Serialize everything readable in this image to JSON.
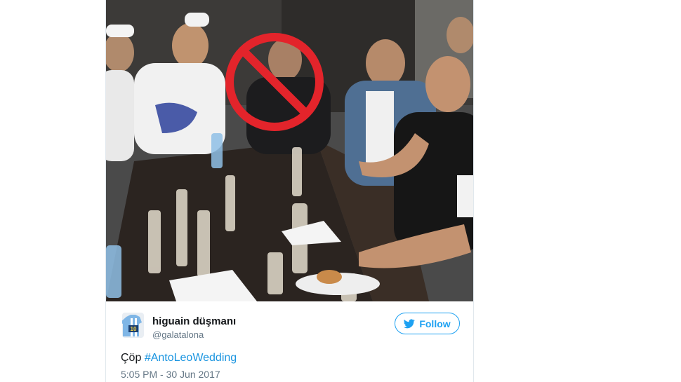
{
  "tweet": {
    "image": {
      "description_icon": "prohibited-sign-icon",
      "accent_red": "#e3242b"
    },
    "author": {
      "display_name": "higuain düşmanı",
      "handle": "@galatalona",
      "avatar_icon": "avatar-jersey-10-icon"
    },
    "follow_label": "Follow",
    "follow_icon": "twitter-bird-icon",
    "text_prefix": "Çöp",
    "hashtag": "#AntoLeoWedding",
    "timestamp": "5:05 PM - 30 Jun 2017"
  },
  "colors": {
    "link": "#1b95e0",
    "follow_blue": "#1da1f2",
    "muted": "#657786",
    "text": "#14171a"
  }
}
